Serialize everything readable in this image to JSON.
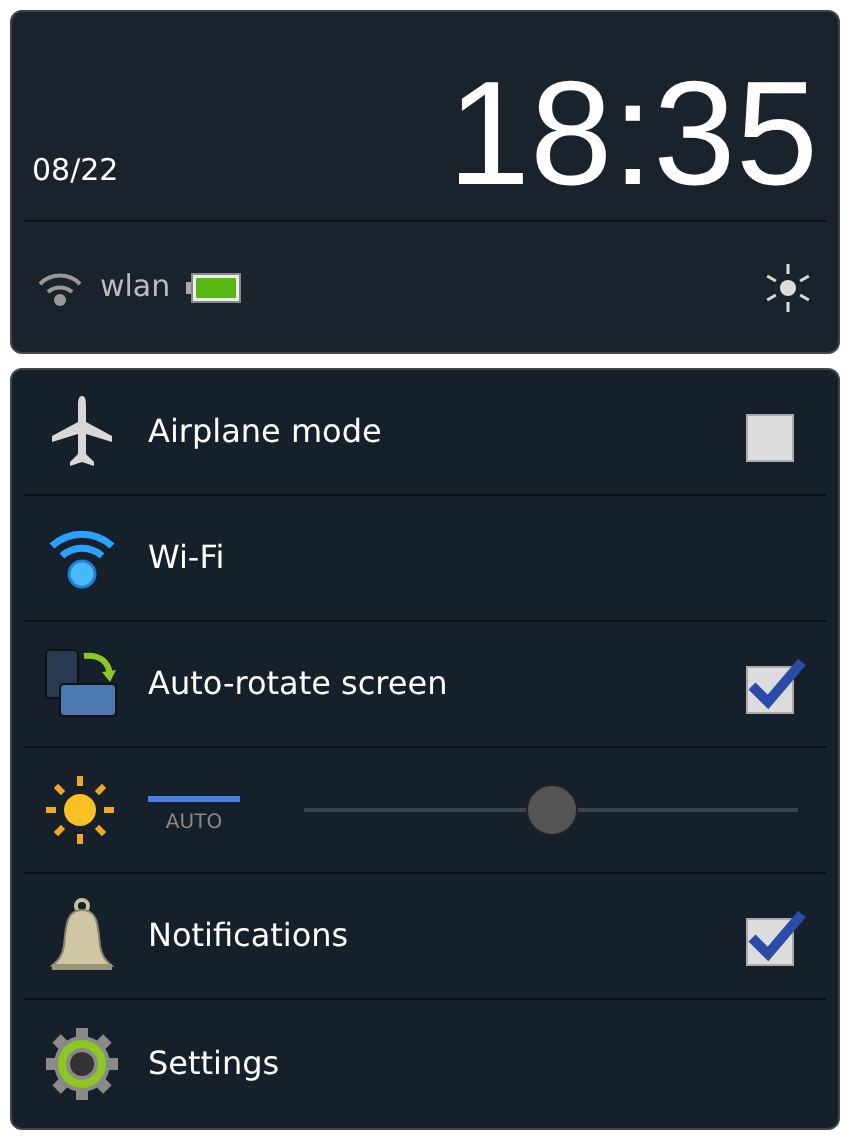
{
  "header": {
    "date": "08/22",
    "time": "18:35",
    "network": "wlan"
  },
  "rows": [
    {
      "kind": "toggle",
      "label": "Airplane mode",
      "checked": false
    },
    {
      "kind": "plain",
      "label": "Wi-Fi"
    },
    {
      "kind": "toggle",
      "label": "Auto-rotate screen",
      "checked": true
    },
    {
      "kind": "brightness",
      "auto_label": "AUTO",
      "auto": true,
      "level": 0.5
    },
    {
      "kind": "toggle",
      "label": "Notifications",
      "checked": true
    },
    {
      "kind": "plain",
      "label": "Settings"
    }
  ]
}
